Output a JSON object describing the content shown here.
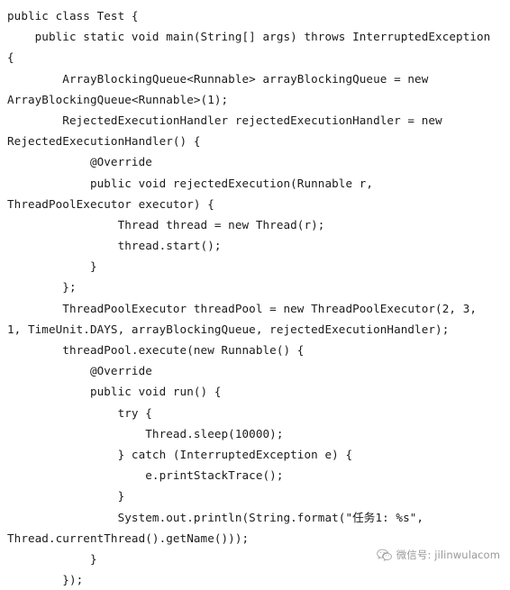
{
  "document": {
    "type": "code-snippet",
    "language": "java",
    "background_color": "#ffffff",
    "text_color": "#1a1a1a"
  },
  "code": {
    "lines": [
      "public class Test {",
      "    public static void main(String[] args) throws InterruptedException",
      "{",
      "        ArrayBlockingQueue<Runnable> arrayBlockingQueue = new",
      "ArrayBlockingQueue<Runnable>(1);",
      "        RejectedExecutionHandler rejectedExecutionHandler = new",
      "RejectedExecutionHandler() {",
      "            @Override",
      "            public void rejectedExecution(Runnable r,",
      "ThreadPoolExecutor executor) {",
      "                Thread thread = new Thread(r);",
      "                thread.start();",
      "            }",
      "        };",
      "        ThreadPoolExecutor threadPool = new ThreadPoolExecutor(2, 3,",
      "1, TimeUnit.DAYS, arrayBlockingQueue, rejectedExecutionHandler);",
      "        threadPool.execute(new Runnable() {",
      "            @Override",
      "            public void run() {",
      "                try {",
      "                    Thread.sleep(10000);",
      "                } catch (InterruptedException e) {",
      "                    e.printStackTrace();",
      "                }",
      "                System.out.println(String.format(\"任务1: %s\",",
      "Thread.currentThread().getName()));",
      "            }",
      "        });"
    ]
  },
  "watermark": {
    "icon": "wechat-logo-icon",
    "text": "微信号: jilinwulacom",
    "color": "#5a5a5a"
  }
}
